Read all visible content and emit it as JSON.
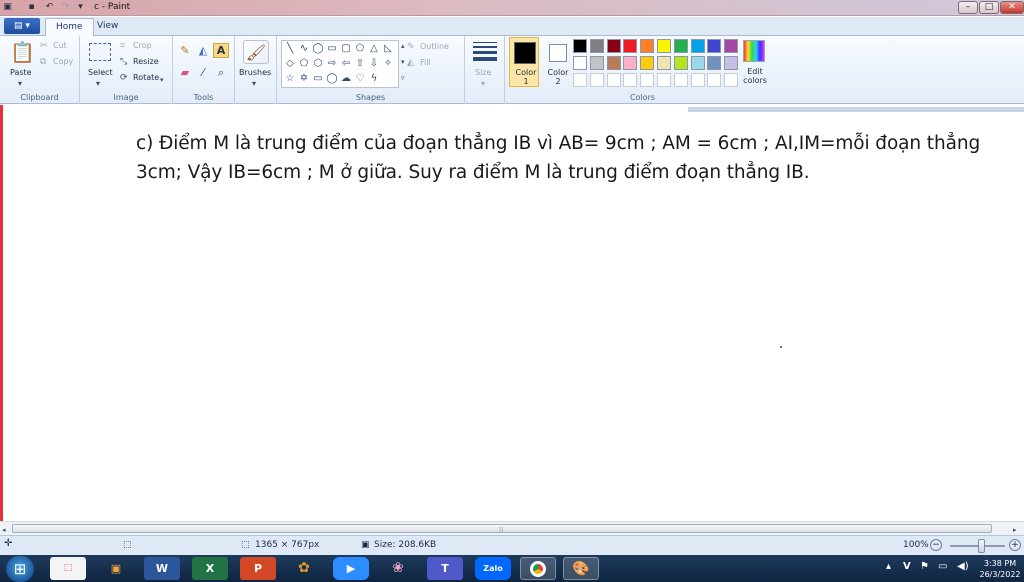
{
  "window": {
    "title": "c - Paint"
  },
  "tabs": [
    "Home",
    "View"
  ],
  "ribbon": {
    "clipboard": {
      "label": "Clipboard",
      "paste": "Paste",
      "cut": "Cut",
      "copy": "Copy"
    },
    "image": {
      "label": "Image",
      "select": "Select",
      "crop": "Crop",
      "resize": "Resize",
      "rotate": "Rotate"
    },
    "tools": {
      "label": "Tools"
    },
    "brushes": {
      "label": "Brushes"
    },
    "shapes": {
      "label": "Shapes",
      "outline": "Outline",
      "fill": "Fill"
    },
    "size": {
      "label": "Size"
    },
    "colors": {
      "label": "Colors",
      "color1": "Color 1",
      "color2": "Color 2",
      "edit": "Edit colors",
      "palette_row1": [
        "#000000",
        "#7f7f7f",
        "#880015",
        "#ed1c24",
        "#ff7f27",
        "#fff200",
        "#22b14c",
        "#00a2e8",
        "#3f48cc",
        "#a349a4"
      ],
      "palette_row2": [
        "#ffffff",
        "#c3c3c3",
        "#b97a57",
        "#ffaec9",
        "#ffc90e",
        "#efe4b0",
        "#b5e61d",
        "#99d9ea",
        "#7092be",
        "#c8bfe7"
      ]
    }
  },
  "canvas": {
    "text": "c) Điểm M là trung điểm của đoạn thẳng IB vì AB= 9cm ; AM = 6cm ; AI,IM=mỗi đoạn thẳng 3cm; Vậy IB=6cm ; M ở giữa. Suy ra điểm M là trung điểm đoạn thẳng IB."
  },
  "status": {
    "dimensions": "1365 × 767px",
    "size": "Size: 208.6KB",
    "zoom": "100%"
  },
  "taskbar": {
    "time": "3:38 PM",
    "date": "26/3/2022",
    "zalo": "Zalo",
    "tray_v": "V"
  }
}
